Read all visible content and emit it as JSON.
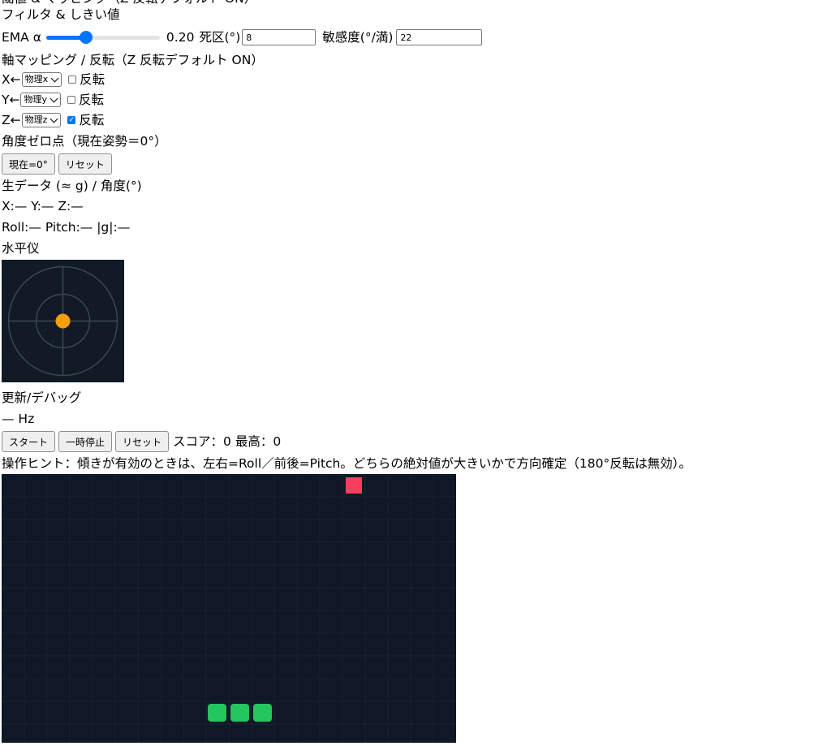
{
  "cut_heading": "閾値 & マッピング（Z 反転デフォルト ON）",
  "filter": {
    "heading": "フィルタ & しきい値",
    "ema_label": "EMA α",
    "ema_fraction": 0.35,
    "ema_value": "0.20",
    "deadzone_label": "死区(°)",
    "deadzone_value": "8",
    "sensitivity_label": "敏感度(°/満)",
    "sensitivity_value": "22"
  },
  "mapping": {
    "heading": "軸マッピング / 反転（Z 反転デフォルト ON）",
    "invert_label": "反転",
    "rows": [
      {
        "axis_label": "X←",
        "select_value": "物理x",
        "invert": false
      },
      {
        "axis_label": "Y←",
        "select_value": "物理y",
        "invert": false
      },
      {
        "axis_label": "Z←",
        "select_value": "物理z",
        "invert": true
      }
    ]
  },
  "zero": {
    "heading": "角度ゼロ点（現在姿勢＝0°）",
    "set_button": "現在=0°",
    "reset_button": "リセット"
  },
  "raw": {
    "heading": "生データ (≈ g) / 角度(°)",
    "xyz_line": "X:— Y:— Z:—",
    "angles_line": "Roll:— Pitch:— |g|:—"
  },
  "level": {
    "heading": "水平仪",
    "bubble_color": "#f59e0b",
    "ring_color": "#3b4656"
  },
  "debug": {
    "heading": "更新/デバッグ",
    "rate": "— Hz"
  },
  "game": {
    "start_button": "スタート",
    "pause_button": "一時停止",
    "reset_button": "リセット",
    "score_text": "スコア：0 最高：0",
    "hint": "操作ヒント：傾きが有効のときは、左右=Roll／前後=Pitch。どちらの絶対値が大きいかで方向確定（180°反転は無効）。",
    "board_color": "#101827",
    "grid_color": "#172033",
    "snake_color": "#22c55e",
    "food_color": "#f43f5e"
  }
}
